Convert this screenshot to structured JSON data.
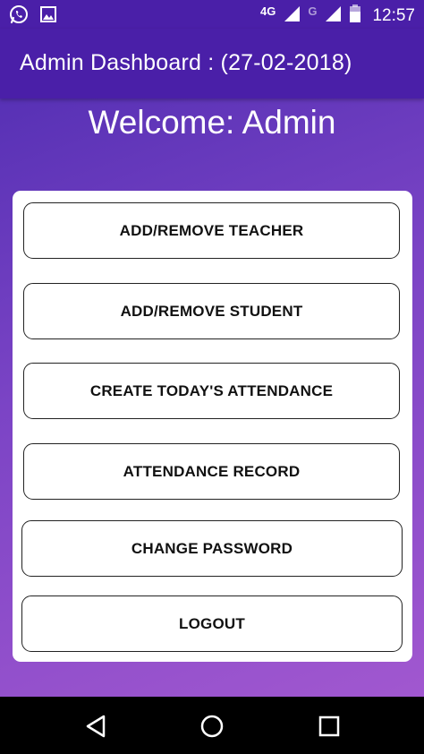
{
  "status_bar": {
    "network_primary": "4G",
    "network_secondary": "G",
    "time": "12:57",
    "icons": [
      "whatsapp-icon",
      "image-icon",
      "signal-icon",
      "signal-icon",
      "battery-icon"
    ]
  },
  "app_bar": {
    "title": "Admin Dashboard : (27-02-2018)"
  },
  "welcome": "Welcome: Admin",
  "menu": {
    "add_remove_teacher": "ADD/REMOVE TEACHER",
    "add_remove_student": "ADD/REMOVE STUDENT",
    "create_attendance": "CREATE TODAY'S ATTENDANCE",
    "attendance_record": "ATTENDANCE RECORD",
    "change_password": "CHANGE PASSWORD",
    "logout": "LOGOUT"
  },
  "nav_bar": {
    "icons": [
      "back-icon",
      "home-icon",
      "recents-icon"
    ]
  },
  "colors": {
    "app_bar": "#4a1fa8",
    "gradient_top": "#4c2bb0",
    "gradient_bottom": "#a65ad1",
    "card": "#ffffff"
  }
}
